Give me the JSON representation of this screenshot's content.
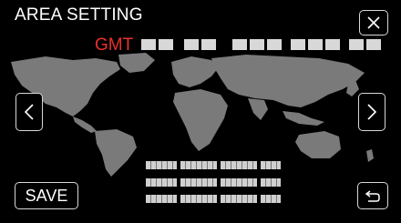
{
  "header": {
    "title": "AREA SETTING",
    "gmt_label": "GMT"
  },
  "buttons": {
    "close_icon": "close-icon",
    "prev_icon": "chevron-left-icon",
    "next_icon": "chevron-right-icon",
    "save_label": "SAVE",
    "back_icon": "return-icon"
  },
  "map": {
    "description_icon": "world-map-icon"
  },
  "colors": {
    "background": "#000000",
    "gmt_text": "#e8322e",
    "map_land": "#7a7a7a",
    "button_border": "#d8d8d8"
  }
}
